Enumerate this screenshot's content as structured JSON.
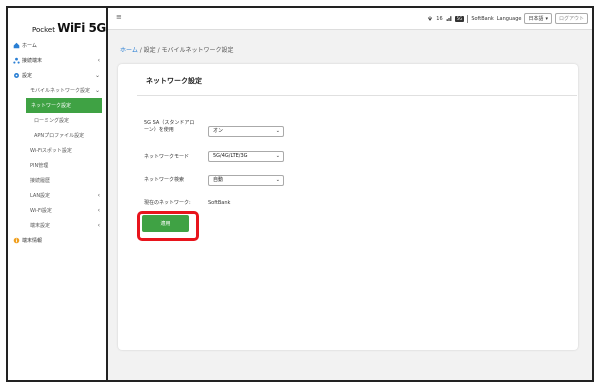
{
  "logo": {
    "prefix": "Pocket",
    "brand": "WiFi 5G"
  },
  "sidebar": {
    "items": [
      {
        "label": "ホーム"
      },
      {
        "label": "接続端末"
      },
      {
        "label": "設定"
      },
      {
        "label": "モバイルネットワーク設定"
      },
      {
        "label": "ネットワーク設定"
      },
      {
        "label": "ローミング設定"
      },
      {
        "label": "APNプロファイル設定"
      },
      {
        "label": "Wi-Fiスポット設定"
      },
      {
        "label": "PIN管理"
      },
      {
        "label": "接続履歴"
      },
      {
        "label": "LAN設定"
      },
      {
        "label": "Wi-Fi設定"
      },
      {
        "label": "端末設定"
      },
      {
        "label": "端末情報"
      }
    ]
  },
  "topbar": {
    "menu_icon": "≡",
    "signal_value": "16",
    "network_badge": "5G",
    "carrier": "SoftBank",
    "language_label": "Language",
    "language_value": "日本語",
    "logout_label": "ログアウト"
  },
  "breadcrumb": {
    "home": "ホーム",
    "sep1": " / ",
    "settings": "設定",
    "sep2": " / ",
    "current": "モバイルネットワーク設定"
  },
  "card": {
    "title": "ネットワーク設定",
    "sa_label_line1": "5G SA（スタンドアロ",
    "sa_label_line2": "ーン）を使用",
    "sa_value": "オン",
    "mode_label": "ネットワークモード",
    "mode_value": "5G/4G/LTE/3G",
    "search_label": "ネットワーク検索",
    "search_value": "自動",
    "current_label": "現在のネットワーク:",
    "current_value": "SoftBank",
    "apply_label": "適用"
  },
  "colors": {
    "accent_green": "#3fa244",
    "highlight_red": "#e8141c",
    "link_blue": "#2a7fd4"
  }
}
